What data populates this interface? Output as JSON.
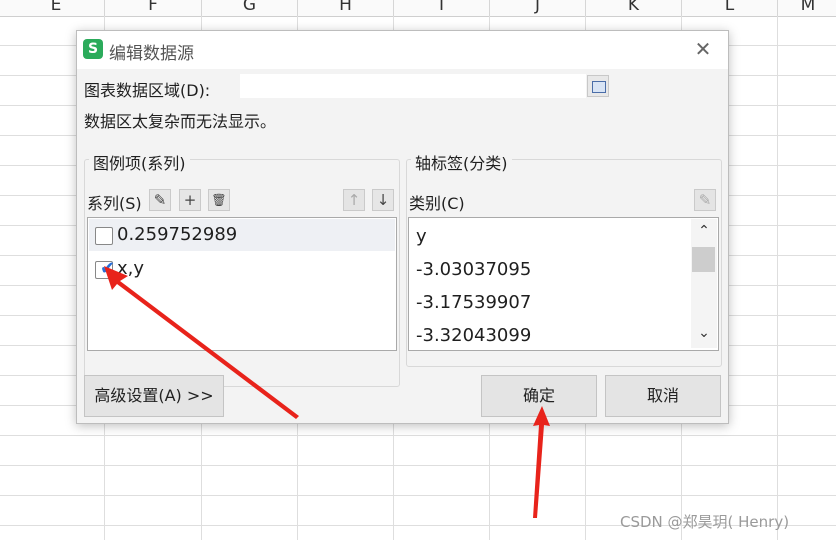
{
  "spreadsheet": {
    "columns": [
      "E",
      "F",
      "G",
      "H",
      "I",
      "J",
      "K",
      "L",
      "M"
    ]
  },
  "dialog": {
    "app_icon_letter": "S",
    "title": "编辑数据源",
    "close_glyph": "✕",
    "range_label": "图表数据区域(D):",
    "range_value": "",
    "message": "数据区太复杂而无法显示。",
    "legend_group": {
      "title": "图例项(系列)",
      "series_label": "系列(S)",
      "toolbar": {
        "edit_glyph": "✎",
        "add_glyph": "+",
        "delete_glyph": "🗑",
        "up_glyph": "↑",
        "down_glyph": "↓"
      },
      "series": [
        {
          "label": "0.259752989",
          "checked": false
        },
        {
          "label": "x,y",
          "checked": true
        }
      ]
    },
    "axis_group": {
      "title": "轴标签(分类)",
      "category_label": "类别(C)",
      "edit_glyph": "✎",
      "categories": [
        "y",
        "-3.03037095",
        "-3.17539907",
        "-3.32043099"
      ],
      "scroll_up_glyph": "⌃",
      "scroll_down_glyph": "⌄"
    },
    "advanced_button": "高级设置(A) >>",
    "ok_button": "确定",
    "cancel_button": "取消"
  },
  "annotations": {
    "arrow_color": "#e8231b"
  },
  "watermark": "CSDN @郑昊玥( Henry)"
}
